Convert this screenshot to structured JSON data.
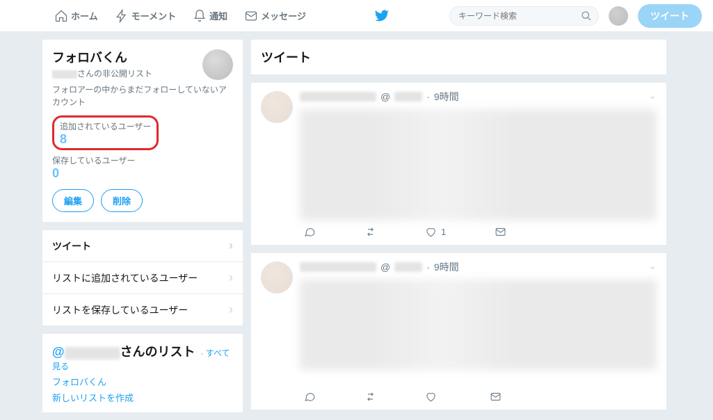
{
  "nav": {
    "home": "ホーム",
    "moments": "モーメント",
    "notifications": "通知",
    "messages": "メッセージ",
    "search_placeholder": "キーワード検索",
    "tweet_button": "ツイート"
  },
  "list": {
    "title": "フォロバくん",
    "subtitle_suffix": "さんの非公開リスト",
    "description": "フォロアーの中からまだフォローしていないアカウント",
    "stats": {
      "members_label": "追加されているユーザー",
      "members_count": "8",
      "subscribers_label": "保存しているユーザー",
      "subscribers_count": "0"
    },
    "edit": "編集",
    "delete": "削除"
  },
  "tabs": {
    "tweets": "ツイート",
    "members": "リストに追加されているユーザー",
    "subscribers": "リストを保存しているユーザー"
  },
  "user_lists": {
    "at": "@",
    "suffix": "さんのリスト",
    "view_all": "すべて見る",
    "list1": "フォロバくん",
    "create": "新しいリストを作成"
  },
  "main": {
    "heading": "ツイート"
  },
  "tweets": [
    {
      "handle_prefix": "@",
      "sep": "·",
      "time": "9時間",
      "like_count": "1"
    },
    {
      "handle_prefix": "@",
      "sep": "·",
      "time": "9時間",
      "like_count": ""
    }
  ]
}
